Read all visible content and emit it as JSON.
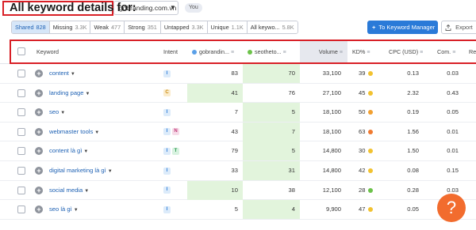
{
  "header": {
    "title": "All keyword details for:",
    "domain_value": "gobranding.com.vn",
    "you_badge": "You"
  },
  "filters": [
    {
      "label": "Shared",
      "count": "828",
      "active": true
    },
    {
      "label": "Missing",
      "count": "3.3K",
      "active": false
    },
    {
      "label": "Weak",
      "count": "477",
      "active": false
    },
    {
      "label": "Strong",
      "count": "351",
      "active": false
    },
    {
      "label": "Untapped",
      "count": "3.3K",
      "active": false
    },
    {
      "label": "Unique",
      "count": "1.1K",
      "active": false
    },
    {
      "label": "All keywo...",
      "count": "5.8K",
      "active": false
    }
  ],
  "actions": {
    "manager_plus": "+",
    "manager_label": "To Keyword Manager",
    "export_label": "Export"
  },
  "columns": {
    "keyword": "Keyword",
    "intent": "Intent",
    "domain1": "gobrandin...",
    "domain2": "seotheto...",
    "volume": "Volume",
    "kd": "KD%",
    "cpc": "CPC (USD)",
    "com": "Com.",
    "results": "Re"
  },
  "colors": {
    "domain1_dot": "#5aa0e8",
    "domain2_dot": "#6cc24a",
    "accent": "#2a7ad8",
    "highlight": "#d81f26"
  },
  "rows": [
    {
      "keyword": "content",
      "intents": [
        "I"
      ],
      "pos1": "83",
      "pos2": "70",
      "best": "pos2",
      "volume": "33,100",
      "kd": "39",
      "kd_color": "#f2c230",
      "cpc": "0.13",
      "com": "0.03"
    },
    {
      "keyword": "landing page",
      "intents": [
        "C"
      ],
      "pos1": "41",
      "pos2": "76",
      "best": "pos1",
      "volume": "27,100",
      "kd": "45",
      "kd_color": "#f2c230",
      "cpc": "2.32",
      "com": "0.43"
    },
    {
      "keyword": "seo",
      "intents": [
        "I"
      ],
      "pos1": "7",
      "pos2": "5",
      "best": "pos2",
      "volume": "18,100",
      "kd": "50",
      "kd_color": "#f2a030",
      "cpc": "0.19",
      "com": "0.05"
    },
    {
      "keyword": "webmaster tools",
      "intents": [
        "I",
        "N"
      ],
      "pos1": "43",
      "pos2": "7",
      "best": "pos2",
      "volume": "18,100",
      "kd": "63",
      "kd_color": "#f07a30",
      "cpc": "1.56",
      "com": "0.01"
    },
    {
      "keyword": "content là gì",
      "intents": [
        "I",
        "T"
      ],
      "pos1": "79",
      "pos2": "5",
      "best": "pos2",
      "volume": "14,800",
      "kd": "30",
      "kd_color": "#f2c230",
      "cpc": "1.50",
      "com": "0.01"
    },
    {
      "keyword": "digital marketing là gì",
      "intents": [
        "I"
      ],
      "pos1": "33",
      "pos2": "31",
      "best": "pos2",
      "volume": "14,800",
      "kd": "42",
      "kd_color": "#f2c230",
      "cpc": "0.08",
      "com": "0.15"
    },
    {
      "keyword": "social media",
      "intents": [
        "I"
      ],
      "pos1": "10",
      "pos2": "38",
      "best": "pos1",
      "volume": "12,100",
      "kd": "28",
      "kd_color": "#6cc24a",
      "cpc": "0.28",
      "com": "0.03"
    },
    {
      "keyword": "seo là gì",
      "intents": [
        "I"
      ],
      "pos1": "5",
      "pos2": "4",
      "best": "pos2",
      "volume": "9,900",
      "kd": "47",
      "kd_color": "#f2c230",
      "cpc": "0.05",
      "com": "0.02"
    }
  ],
  "help": {
    "label": "?"
  }
}
